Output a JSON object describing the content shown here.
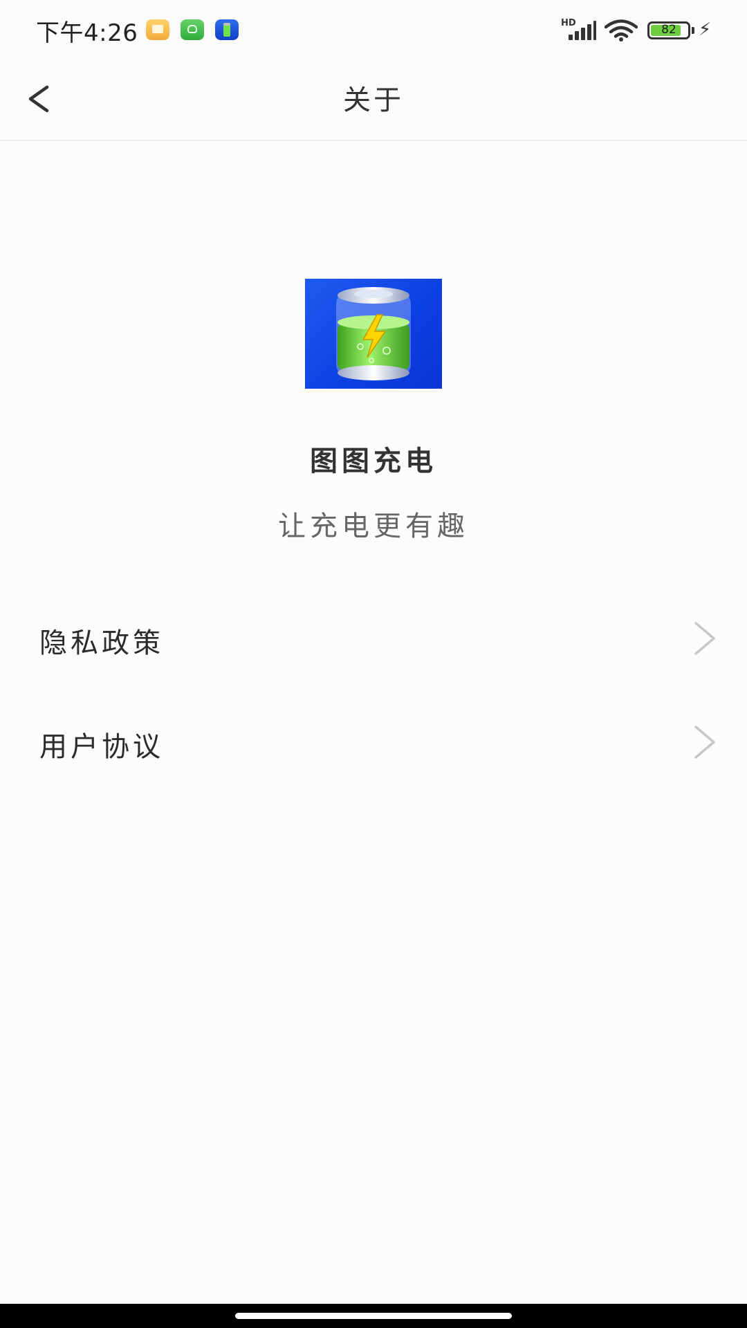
{
  "status_bar": {
    "time": "下午4:26",
    "network_label": "HD",
    "battery_level": "82",
    "battery_percent": 82,
    "notification_icons": [
      "gallery-notification-icon",
      "android-notification-icon",
      "battery-app-notification-icon"
    ]
  },
  "nav": {
    "title": "关于",
    "back_icon": "chevron-left-icon"
  },
  "app": {
    "name": "图图充电",
    "slogan": "让充电更有趣",
    "logo_icon": "battery-app-logo",
    "logo_colors": {
      "background": "#0c3fe2",
      "liquid": "#6ccd3e",
      "bolt": "#ffd400"
    }
  },
  "list": {
    "items": [
      {
        "label": "隐私政策",
        "icon": "chevron-right-icon"
      },
      {
        "label": "用户协议",
        "icon": "chevron-right-icon"
      }
    ]
  }
}
